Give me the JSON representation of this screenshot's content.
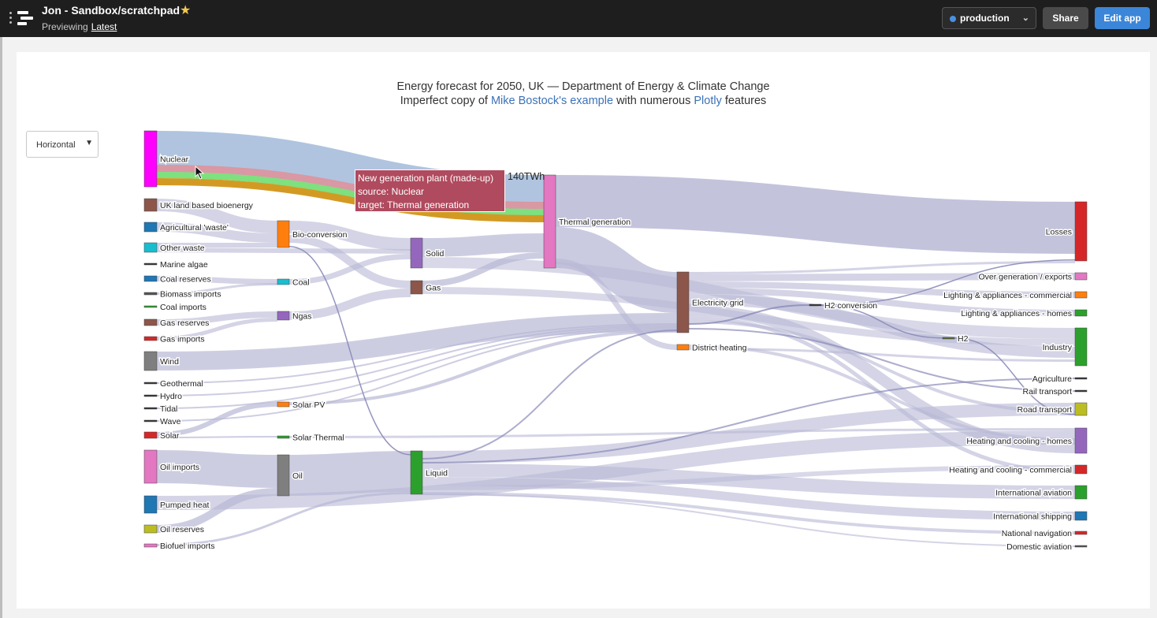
{
  "header": {
    "title": "Jon - Sandbox/scratchpad",
    "previewing": "Previewing",
    "version": "Latest",
    "environment": "production",
    "share": "Share",
    "edit": "Edit app"
  },
  "chart": {
    "title_line1": "Energy forecast for 2050, UK — Department of Energy & Climate Change",
    "title_pre": "Imperfect copy of",
    "title_link1": "Mike Bostock's example",
    "title_mid": "with numerous",
    "title_link2": "Plotly",
    "title_post": "features",
    "orientation": "Horizontal"
  },
  "tooltip": {
    "line1": "New generation plant (made-up)",
    "line2": "source: Nuclear",
    "line3": "target: Thermal generation",
    "value": "140TWh"
  },
  "chart_data": {
    "type": "sankey",
    "nodes": [
      {
        "id": "nuclear",
        "label": "Nuclear",
        "color": "#ff00ff"
      },
      {
        "id": "bio",
        "label": "UK land based bioenergy",
        "color": "#8c564b"
      },
      {
        "id": "agri",
        "label": "Agricultural 'waste'",
        "color": "#1f77b4"
      },
      {
        "id": "otherwaste",
        "label": "Other waste",
        "color": "#17becf"
      },
      {
        "id": "algae",
        "label": "Marine algae",
        "color": "#333333"
      },
      {
        "id": "coalres",
        "label": "Coal reserves",
        "color": "#1f77b4"
      },
      {
        "id": "biomass",
        "label": "Biomass imports",
        "color": "#555555"
      },
      {
        "id": "coalimp",
        "label": "Coal imports",
        "color": "#2ca02c"
      },
      {
        "id": "gasres",
        "label": "Gas reserves",
        "color": "#8c564b"
      },
      {
        "id": "gasimp",
        "label": "Gas imports",
        "color": "#d62728"
      },
      {
        "id": "wind",
        "label": "Wind",
        "color": "#7f7f7f"
      },
      {
        "id": "geo",
        "label": "Geothermal",
        "color": "#333333"
      },
      {
        "id": "hydro",
        "label": "Hydro",
        "color": "#333333"
      },
      {
        "id": "tidal",
        "label": "Tidal",
        "color": "#333333"
      },
      {
        "id": "wave",
        "label": "Wave",
        "color": "#333333"
      },
      {
        "id": "solar",
        "label": "Solar",
        "color": "#d62728"
      },
      {
        "id": "oilimp",
        "label": "Oil imports",
        "color": "#e377c2"
      },
      {
        "id": "pumped",
        "label": "Pumped heat",
        "color": "#1f77b4"
      },
      {
        "id": "oilres",
        "label": "Oil reserves",
        "color": "#bcbd22"
      },
      {
        "id": "biofuel",
        "label": "Biofuel imports",
        "color": "#e377c2"
      },
      {
        "id": "bioconv",
        "label": "Bio-conversion",
        "color": "#ff7f0e"
      },
      {
        "id": "coal",
        "label": "Coal",
        "color": "#17becf"
      },
      {
        "id": "ngas",
        "label": "Ngas",
        "color": "#9467bd"
      },
      {
        "id": "solarpv",
        "label": "Solar PV",
        "color": "#ff7f0e"
      },
      {
        "id": "solarth",
        "label": "Solar Thermal",
        "color": "#2ca02c"
      },
      {
        "id": "oil",
        "label": "Oil",
        "color": "#7f7f7f"
      },
      {
        "id": "solid",
        "label": "Solid",
        "color": "#9467bd"
      },
      {
        "id": "gas",
        "label": "Gas",
        "color": "#8c564b"
      },
      {
        "id": "liquid",
        "label": "Liquid",
        "color": "#2ca02c"
      },
      {
        "id": "thermal",
        "label": "Thermal generation",
        "color": "#e377c2"
      },
      {
        "id": "grid",
        "label": "Electricity grid",
        "color": "#8c564b"
      },
      {
        "id": "district",
        "label": "District heating",
        "color": "#ff7f0e"
      },
      {
        "id": "h2conv",
        "label": "H2 conversion",
        "color": "#333333"
      },
      {
        "id": "h2",
        "label": "H2",
        "color": "#556b2f"
      },
      {
        "id": "losses",
        "label": "Losses",
        "color": "#d62728"
      },
      {
        "id": "overgen",
        "label": "Over generation / exports",
        "color": "#e377c2"
      },
      {
        "id": "lightcom",
        "label": "Lighting & appliances - commercial",
        "color": "#ff7f0e"
      },
      {
        "id": "lighthome",
        "label": "Lighting & appliances - homes",
        "color": "#2ca02c"
      },
      {
        "id": "industry",
        "label": "Industry",
        "color": "#2ca02c"
      },
      {
        "id": "agriculture",
        "label": "Agriculture",
        "color": "#333333"
      },
      {
        "id": "rail",
        "label": "Rail transport",
        "color": "#333333"
      },
      {
        "id": "road",
        "label": "Road transport",
        "color": "#bcbd22"
      },
      {
        "id": "heathome",
        "label": "Heating and cooling - homes",
        "color": "#9467bd"
      },
      {
        "id": "heatcom",
        "label": "Heating and cooling - commercial",
        "color": "#d62728"
      },
      {
        "id": "intaviation",
        "label": "International aviation",
        "color": "#2ca02c"
      },
      {
        "id": "intshipping",
        "label": "International shipping",
        "color": "#1f77b4"
      },
      {
        "id": "natnav",
        "label": "National navigation",
        "color": "#d62728"
      },
      {
        "id": "domaviation",
        "label": "Domestic aviation",
        "color": "#555555"
      }
    ]
  }
}
